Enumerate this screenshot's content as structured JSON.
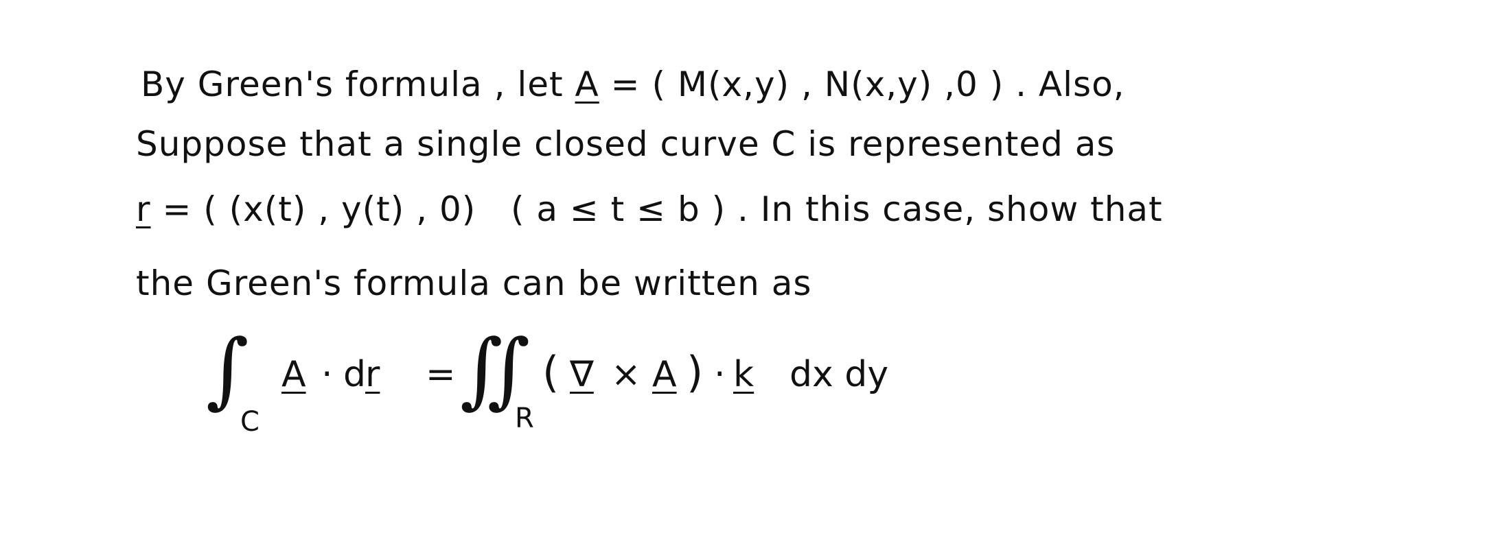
{
  "document": {
    "paragraph": {
      "line1": {
        "text_a": "By Green's formula , let",
        "vector_A": "A",
        "text_b": "= ( M(x,y) , N(x,y) ,0 ) . Also,"
      },
      "line2": {
        "text": "Suppose that a single closed curve C is represented as"
      },
      "line3": {
        "vector_r": "r",
        "text_a": "= ( (x(t) , y(t) , 0)",
        "condition": "( a ≤ t ≤ b )",
        "text_b": ". In this case, show that"
      },
      "line4": {
        "text": "the Green's formula can be written as"
      }
    },
    "formula": {
      "lhs_integral": "∫",
      "lhs_subscript": "C",
      "lhs_vector_A": "A",
      "lhs_dot": "·",
      "lhs_d": "d",
      "lhs_vector_r": "r",
      "equals": "=",
      "rhs_integral": "∬",
      "rhs_subscript": "R",
      "rhs_open_paren": "(",
      "rhs_nabla": "∇",
      "rhs_cross": "×",
      "rhs_vector_A": "A",
      "rhs_close_paren": ")",
      "rhs_dot": "·",
      "rhs_vector_k": "k",
      "rhs_measure": "dx dy"
    }
  }
}
